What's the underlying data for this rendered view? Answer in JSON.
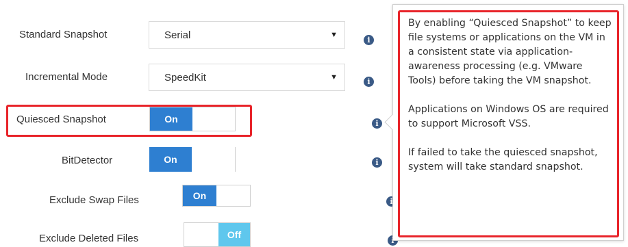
{
  "form": {
    "standard_snapshot": {
      "label": "Standard Snapshot",
      "value": "Serial"
    },
    "incremental_mode": {
      "label": "Incremental Mode",
      "value": "SpeedKit"
    },
    "quiesced_snapshot": {
      "label": "Quiesced Snapshot",
      "state": "On"
    },
    "bit_detector": {
      "label": "BitDetector",
      "state": "On"
    },
    "exclude_swap_files": {
      "label": "Exclude Swap Files",
      "state": "On"
    },
    "exclude_deleted_files": {
      "label": "Exclude Deleted Files",
      "state": "Off"
    }
  },
  "icons": {
    "caret": "caret-down-icon",
    "info": "info-icon",
    "info_glyph": "i"
  },
  "tooltip": {
    "paragraph1": "By enabling “Quiesced Snapshot” to keep file systems or applications on the VM in a consistent state via application-awareness processing (e.g. VMware Tools) before taking the VM snapshot.",
    "paragraph2": "Applications on Windows OS are required to support Microsoft VSS.",
    "paragraph3": "If failed to take the quiesced snapshot, system will take standard snapshot."
  },
  "colors": {
    "toggle_on": "#2e7fd1",
    "toggle_off": "#5fc7ed",
    "highlight": "#e8242a",
    "info_icon": "#3a5a86"
  }
}
